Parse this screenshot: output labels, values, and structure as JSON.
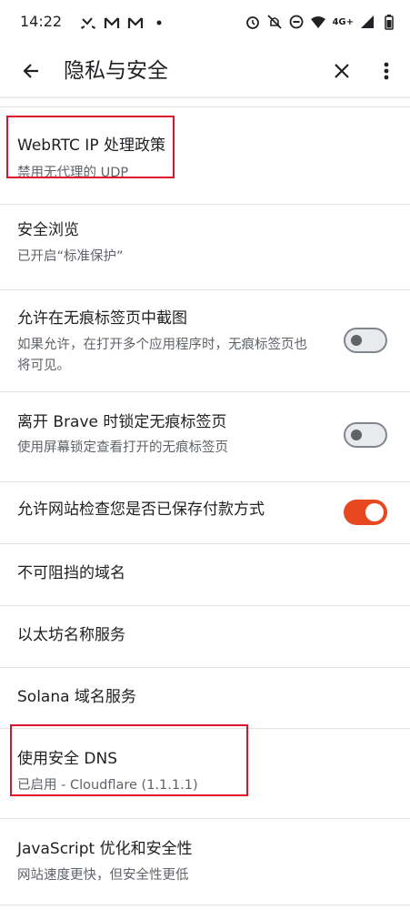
{
  "status_bar": {
    "time": "14:22",
    "left_icons": [
      "missed-call-icon",
      "mail-icon",
      "mail-icon",
      "dot-icon"
    ],
    "right_icons": [
      "alarm-icon",
      "mute-icon",
      "dnd-icon",
      "wifi-icon",
      "signal-icon",
      "battery-icon"
    ],
    "network": "4G+"
  },
  "app_bar": {
    "title": "隐私与安全",
    "back_icon": "arrow-back-icon",
    "close_icon": "close-icon",
    "more_icon": "more-vert-icon"
  },
  "settings": [
    {
      "title": "WebRTC IP 处理政策",
      "subtitle": "禁用无代理的 UDP"
    },
    {
      "title": "安全浏览",
      "subtitle": "已开启“标准保护”"
    },
    {
      "title": "允许在无痕标签页中截图",
      "subtitle": "如果允许，在打开多个应用程序时，无痕标签页也将可见。",
      "toggle": false
    },
    {
      "title": "离开 Brave 时锁定无痕标签页",
      "subtitle": "使用屏幕锁定查看打开的无痕标签页",
      "toggle": false
    },
    {
      "title": "允许网站检查您是否已保存付款方式",
      "toggle": true
    },
    {
      "title": "不可阻挡的域名"
    },
    {
      "title": "以太坊名称服务"
    },
    {
      "title": "Solana 域名服务"
    },
    {
      "title": "使用安全 DNS",
      "subtitle": "已启用 - Cloudflare (1.1.1.1)"
    },
    {
      "title": "JavaScript 优化和安全性",
      "subtitle": "网站速度更快，但安全性更低"
    }
  ],
  "colors": {
    "accent": "#e8481f",
    "highlight": "#e0102a",
    "text_primary": "#202124",
    "text_secondary": "#5f6368"
  }
}
